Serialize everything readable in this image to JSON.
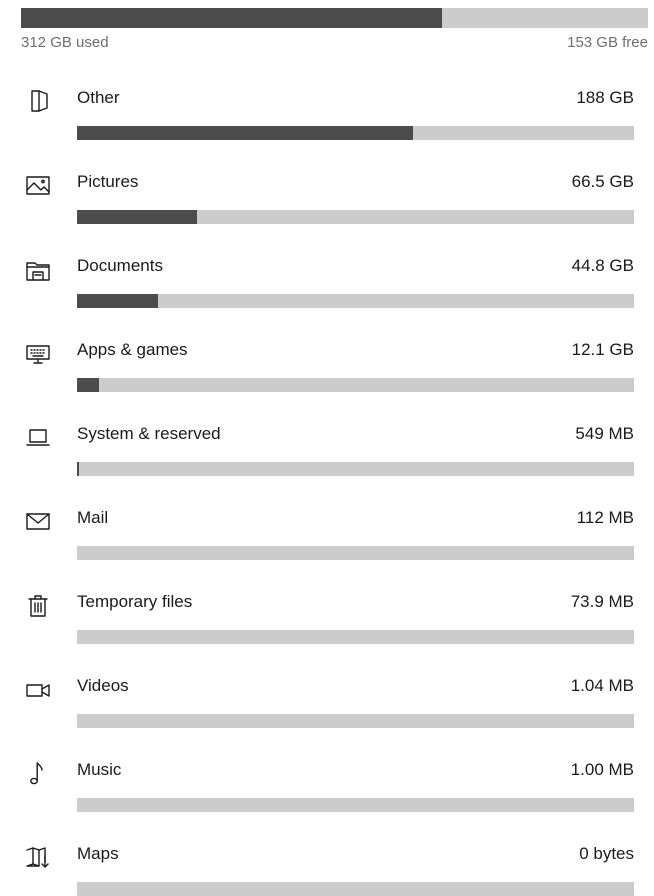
{
  "summary": {
    "used_label": "312 GB used",
    "free_label": "153 GB free",
    "used_fraction": 0.671
  },
  "categories": [
    {
      "name": "Other",
      "size": "188 GB",
      "icon": "other-icon",
      "fraction": 0.603
    },
    {
      "name": "Pictures",
      "size": "66.5 GB",
      "icon": "pictures-icon",
      "fraction": 0.215
    },
    {
      "name": "Documents",
      "size": "44.8 GB",
      "icon": "documents-icon",
      "fraction": 0.145
    },
    {
      "name": "Apps & games",
      "size": "12.1 GB",
      "icon": "apps-games-icon",
      "fraction": 0.039
    },
    {
      "name": "System & reserved",
      "size": "549 MB",
      "icon": "system-icon",
      "fraction": 0.003
    },
    {
      "name": "Mail",
      "size": "112 MB",
      "icon": "mail-icon",
      "fraction": 0.0
    },
    {
      "name": "Temporary files",
      "size": "73.9 MB",
      "icon": "trash-icon",
      "fraction": 0.0
    },
    {
      "name": "Videos",
      "size": "1.04 MB",
      "icon": "video-camera-icon",
      "fraction": 0.0
    },
    {
      "name": "Music",
      "size": "1.00 MB",
      "icon": "music-note-icon",
      "fraction": 0.0
    },
    {
      "name": "Maps",
      "size": "0 bytes",
      "icon": "map-icon",
      "fraction": 0.0
    }
  ]
}
